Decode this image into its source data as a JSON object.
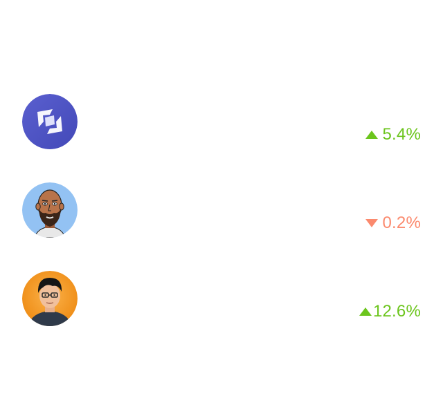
{
  "items": [
    {
      "avatar": "brand-logo-icon",
      "direction": "up",
      "change": "5.4%",
      "color": "#6cc51d",
      "avatar_bg": "#4f55c6"
    },
    {
      "avatar": "bearded-man-avatar",
      "direction": "down",
      "change": "0.2%",
      "color": "#fb8a6e",
      "avatar_bg": "#93c2f3"
    },
    {
      "avatar": "man-with-glasses-avatar",
      "direction": "up",
      "change": "12.6%",
      "color": "#6cc51d",
      "avatar_bg": "#f39a1f"
    }
  ]
}
